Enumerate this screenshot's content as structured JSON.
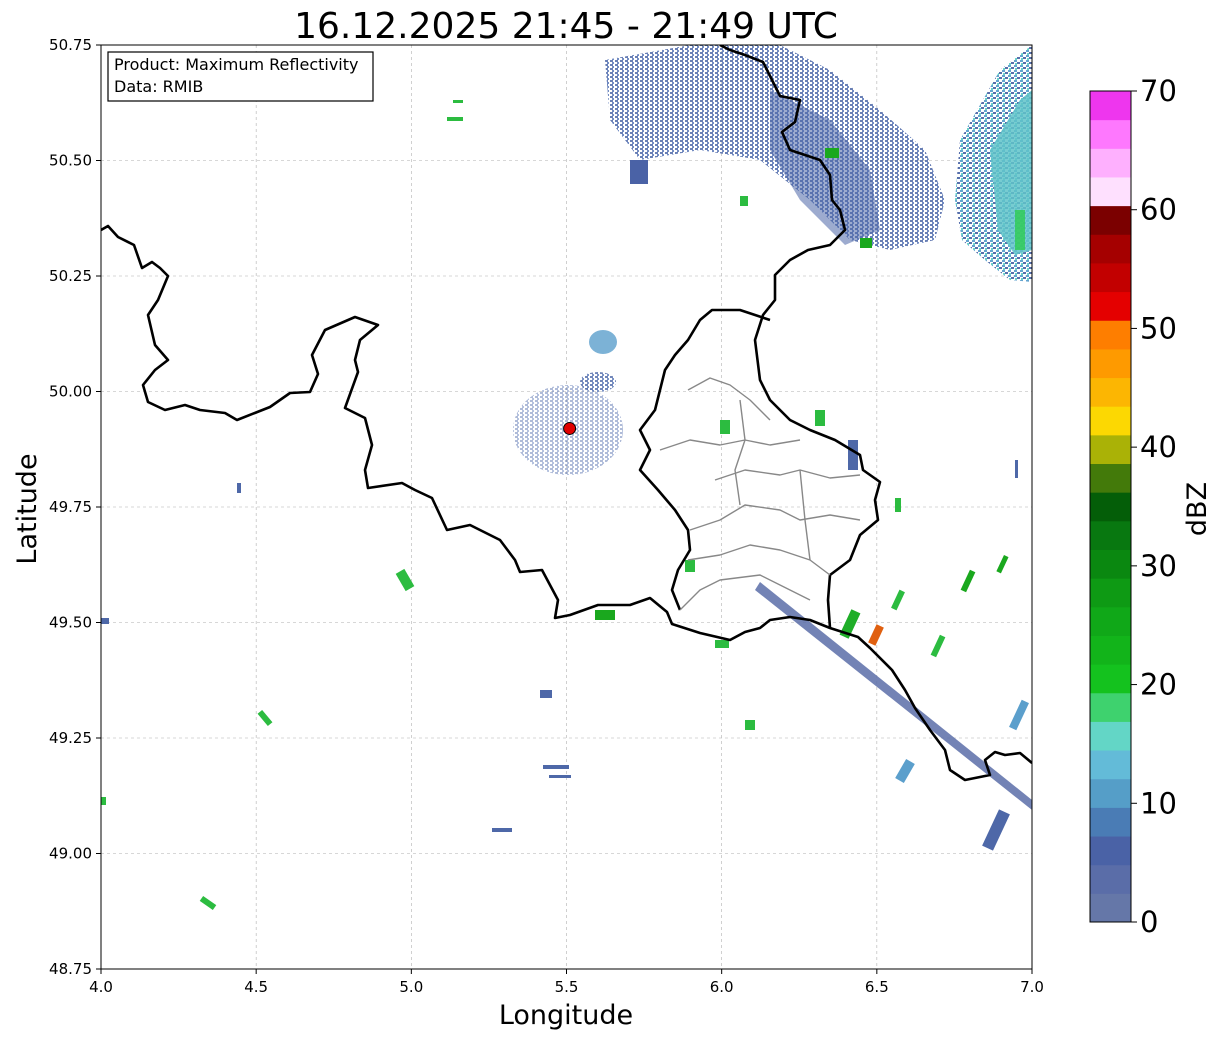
{
  "title": "16.12.2025 21:45 - 21:49 UTC",
  "xlabel": "Longitude",
  "ylabel": "Latitude",
  "annotation": {
    "line1": "Product: Maximum Reflectivity",
    "line2": "Data: RMIB"
  },
  "xlim": [
    4.0,
    7.0
  ],
  "ylim": [
    48.75,
    50.75
  ],
  "x_ticks": [
    {
      "value": 4.0,
      "label": "4.0"
    },
    {
      "value": 4.5,
      "label": "4.5"
    },
    {
      "value": 5.0,
      "label": "5.0"
    },
    {
      "value": 5.5,
      "label": "5.5"
    },
    {
      "value": 6.0,
      "label": "6.0"
    },
    {
      "value": 6.5,
      "label": "6.5"
    },
    {
      "value": 7.0,
      "label": "7.0"
    }
  ],
  "y_ticks": [
    {
      "value": 48.75,
      "label": "48.75"
    },
    {
      "value": 49.0,
      "label": "49.00"
    },
    {
      "value": 49.25,
      "label": "49.25"
    },
    {
      "value": 49.5,
      "label": "49.50"
    },
    {
      "value": 49.75,
      "label": "49.75"
    },
    {
      "value": 50.0,
      "label": "50.00"
    },
    {
      "value": 50.25,
      "label": "50.25"
    },
    {
      "value": 50.5,
      "label": "50.50"
    },
    {
      "value": 50.75,
      "label": "50.75"
    }
  ],
  "grid": true,
  "radar_site": {
    "lon": 5.51,
    "lat": 49.92,
    "color": "#e00000"
  },
  "colorbar": {
    "label": "dBZ",
    "min": 0,
    "max": 70,
    "ticks": [
      {
        "value": 0,
        "label": "0"
      },
      {
        "value": 10,
        "label": "10"
      },
      {
        "value": 20,
        "label": "20"
      },
      {
        "value": 30,
        "label": "30"
      },
      {
        "value": 40,
        "label": "40"
      },
      {
        "value": 50,
        "label": "50"
      },
      {
        "value": 60,
        "label": "60"
      },
      {
        "value": 70,
        "label": "70"
      }
    ],
    "colors": [
      "#6577a8",
      "#5a6da8",
      "#4a62a6",
      "#4a7cb5",
      "#559ec8",
      "#63bbd8",
      "#63d6c6",
      "#3ed26e",
      "#14c21e",
      "#12b41a",
      "#10a818",
      "#0e9a14",
      "#0a8810",
      "#087810",
      "#045e08",
      "#437a0a",
      "#aab206",
      "#fcd802",
      "#fcb602",
      "#fe9a00",
      "#fe7e00",
      "#e40000",
      "#c20000",
      "#a50000",
      "#7b0000",
      "#fee0fe",
      "#feb0fe",
      "#fe78fe",
      "#ee36ee"
    ]
  },
  "chart_data": {
    "type": "heatmap",
    "title": "16.12.2025 21:45 - 21:49 UTC",
    "xlabel": "Longitude",
    "ylabel": "Latitude",
    "xlim": [
      4.0,
      7.0
    ],
    "ylim": [
      48.75,
      50.75
    ],
    "colorbar_label": "dBZ",
    "colorbar_range": [
      0,
      70
    ],
    "grid": true,
    "colorbar_placement": "right",
    "radar_site": {
      "lon": 5.51,
      "lat": 49.92
    },
    "echoes": [
      {
        "region": "north-east corner band",
        "lon": [
          6.75,
          7.0
        ],
        "lat": [
          50.24,
          50.75
        ],
        "dbz_range": [
          2,
          25
        ]
      },
      {
        "region": "north cluster",
        "lon": [
          5.65,
          6.45
        ],
        "lat": [
          50.35,
          50.75
        ],
        "dbz_range": [
          2,
          45
        ]
      },
      {
        "region": "streak south-east",
        "lon": [
          6.2,
          7.0
        ],
        "lat": [
          49.1,
          49.5
        ],
        "dbz_range": [
          2,
          10
        ]
      },
      {
        "region": "scattered cells east",
        "lon": [
          6.3,
          6.9
        ],
        "lat": [
          49.3,
          49.6
        ],
        "dbz_range": [
          5,
          55
        ]
      },
      {
        "region": "clutter near radar",
        "lon": [
          5.35,
          5.7
        ],
        "lat": [
          49.8,
          50.15
        ],
        "dbz_range": [
          0,
          15
        ]
      }
    ]
  }
}
